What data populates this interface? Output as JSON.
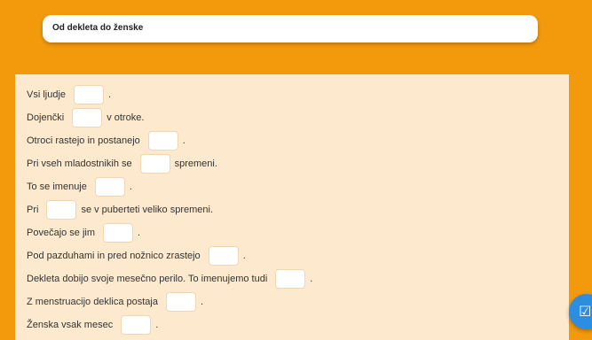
{
  "header": {
    "title": "Od dekleta do ženske"
  },
  "exercise": {
    "lines": [
      {
        "before": "Vsi ljudje",
        "after": "."
      },
      {
        "before": "Dojenčki",
        "after": "v otroke."
      },
      {
        "before": "Otroci rastejo in postanejo",
        "after": "."
      },
      {
        "before": "Pri vseh mladostnikih se",
        "after": "spremeni."
      },
      {
        "before": "To se imenuje",
        "after": "."
      },
      {
        "before": "Pri",
        "after": "se v puberteti veliko spremeni."
      },
      {
        "before": "Povečajo se jim",
        "after": "."
      },
      {
        "before": "Pod pazduhami in pred nožnico zrastejo",
        "after": "."
      },
      {
        "before": "Dekleta dobijo svoje mesečno perilo. To imenujemo tudi",
        "after": "."
      },
      {
        "before": "Z menstruacijo deklica postaja",
        "after": "."
      },
      {
        "before": "Ženska vsak mesec",
        "after": "."
      }
    ]
  },
  "check_button": {
    "icon": "check-square-icon"
  }
}
